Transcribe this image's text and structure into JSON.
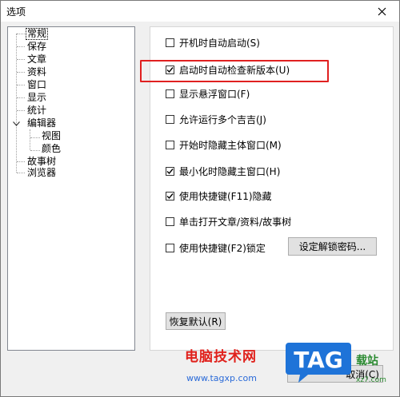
{
  "window": {
    "title": "选项"
  },
  "tree": {
    "items": [
      {
        "label": "常规"
      },
      {
        "label": "保存"
      },
      {
        "label": "文章"
      },
      {
        "label": "资料"
      },
      {
        "label": "窗口"
      },
      {
        "label": "显示"
      },
      {
        "label": "统计"
      },
      {
        "label": "编辑器",
        "expanded": true,
        "children": [
          {
            "label": "视图"
          },
          {
            "label": "颜色"
          }
        ]
      },
      {
        "label": "故事树"
      },
      {
        "label": "浏览器"
      }
    ]
  },
  "options": [
    {
      "label": "开机时自动启动(S)",
      "checked": false
    },
    {
      "label": "启动时自动检查新版本(U)",
      "checked": true
    },
    {
      "label": "显示悬浮窗口(F)",
      "checked": false
    },
    {
      "label": "允许运行多个吉吉(J)",
      "checked": false
    },
    {
      "label": "开始时隐藏主体窗口(M)",
      "checked": false
    },
    {
      "label": "最小化时隐藏主窗口(H)",
      "checked": true
    },
    {
      "label": "使用快捷键(F11)隐藏",
      "checked": true
    },
    {
      "label": "单击打开文章/资料/故事树",
      "checked": false
    },
    {
      "label": "使用快捷键(F2)锁定",
      "checked": false
    }
  ],
  "buttons": {
    "set_password": "设定解锁密码...",
    "restore_default": "恢复默认(R)",
    "cancel_partial": "取消(C)"
  },
  "watermark": {
    "site_name": "电脑技术网",
    "url": "www.tagxp.com",
    "logo_text": "TAG",
    "side_text": "载站",
    "side_small": "xz7.com"
  },
  "colors": {
    "highlight_box": "#e02020",
    "watermark_red": "#e0201b",
    "watermark_blue": "#2a6ad8"
  }
}
